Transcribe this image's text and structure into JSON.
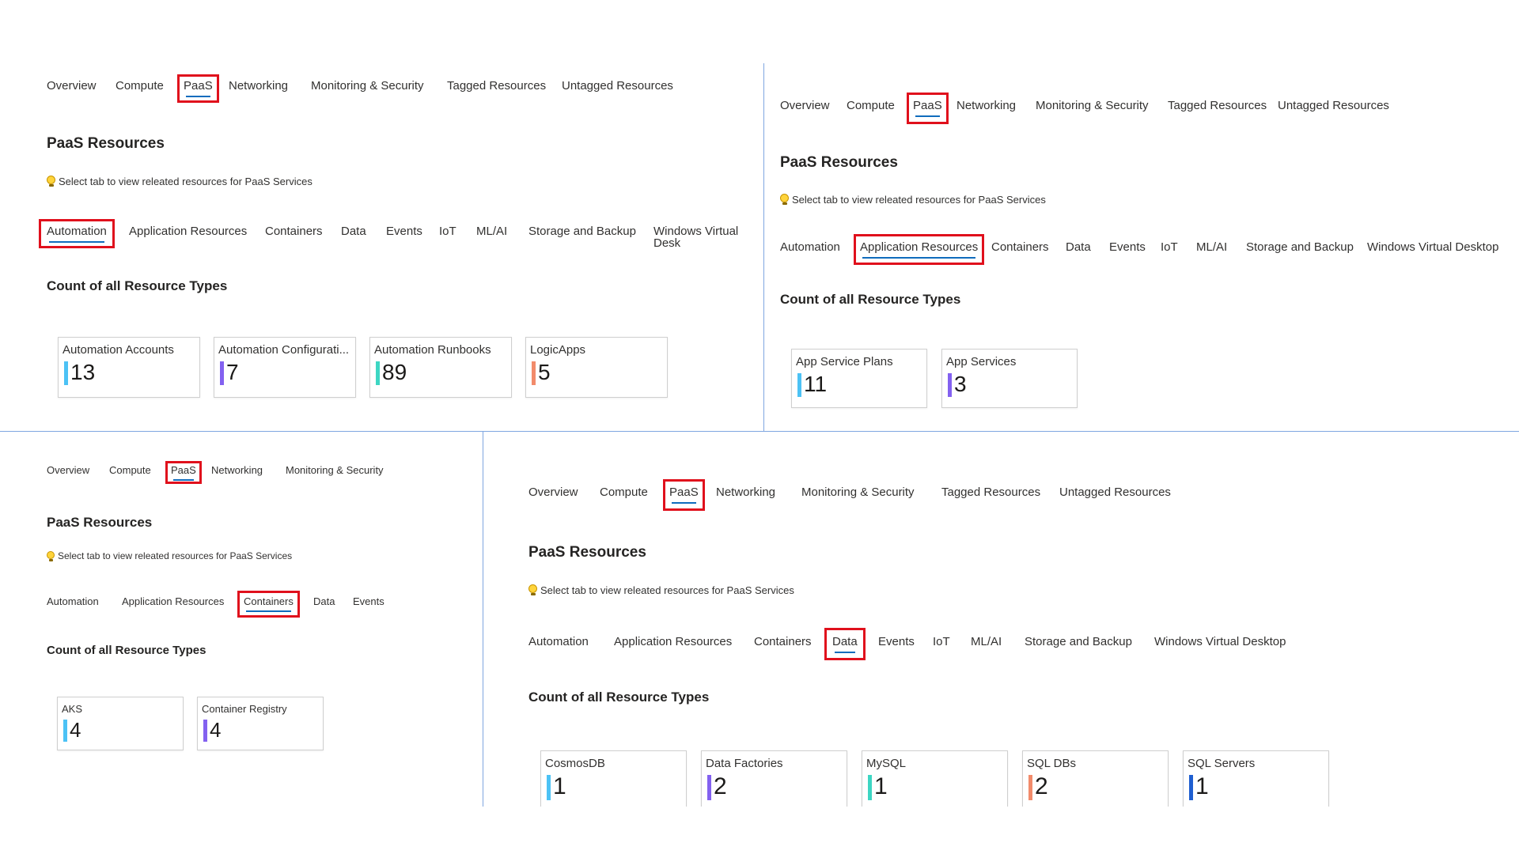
{
  "main_tabs": [
    "Overview",
    "Compute",
    "PaaS",
    "Networking",
    "Monitoring & Security",
    "Tagged Resources",
    "Untagged Resources"
  ],
  "sub_tabs": [
    "Automation",
    "Application Resources",
    "Containers",
    "Data",
    "Events",
    "IoT",
    "ML/AI",
    "Storage and Backup",
    "Windows Virtual Desktop"
  ],
  "page_title": "PaaS Resources",
  "tip_text": "Select tab to view releated resources for PaaS Services",
  "count_heading": "Count of all Resource Types",
  "selected_main_tab": "PaaS",
  "colors": {
    "highlight": "#e0101c",
    "tab_underline": "#0f6cbd",
    "divider": "#7fa6e0",
    "bulb": "#ffd43b"
  },
  "panels": [
    {
      "id": "automation",
      "main_tabs_visible": 7,
      "sub_tabs_visible": 9,
      "selected_sub_tab": "Automation",
      "sub_tab_clipped_text": "Windows Virtual Desk",
      "cards": [
        {
          "label": "Automation Accounts",
          "value": "13",
          "color": "#4cc2f5"
        },
        {
          "label": "Automation Configurati...",
          "value": "7",
          "color": "#8361f0"
        },
        {
          "label": "Automation Runbooks",
          "value": "89",
          "color": "#3dd6c3"
        },
        {
          "label": "LogicApps",
          "value": "5",
          "color": "#f28b6b"
        }
      ]
    },
    {
      "id": "application-resources",
      "main_tabs_visible": 7,
      "sub_tabs_visible": 9,
      "selected_sub_tab": "Application Resources",
      "cards": [
        {
          "label": "App Service Plans",
          "value": "11",
          "color": "#4cc2f5"
        },
        {
          "label": "App Services",
          "value": "3",
          "color": "#8361f0"
        }
      ]
    },
    {
      "id": "containers",
      "main_tabs_visible": 5,
      "sub_tabs_visible": 5,
      "selected_sub_tab": "Containers",
      "cards": [
        {
          "label": "AKS",
          "value": "4",
          "color": "#4cc2f5"
        },
        {
          "label": "Container Registry",
          "value": "4",
          "color": "#8361f0"
        }
      ]
    },
    {
      "id": "data",
      "main_tabs_visible": 7,
      "sub_tabs_visible": 9,
      "selected_sub_tab": "Data",
      "cards": [
        {
          "label": "CosmosDB",
          "value": "1",
          "color": "#4cc2f5"
        },
        {
          "label": "Data Factories",
          "value": "2",
          "color": "#8361f0"
        },
        {
          "label": "MySQL",
          "value": "1",
          "color": "#3dd6c3"
        },
        {
          "label": "SQL DBs",
          "value": "2",
          "color": "#f28b6b"
        },
        {
          "label": "SQL Servers",
          "value": "1",
          "color": "#1f5fd1"
        }
      ]
    }
  ]
}
